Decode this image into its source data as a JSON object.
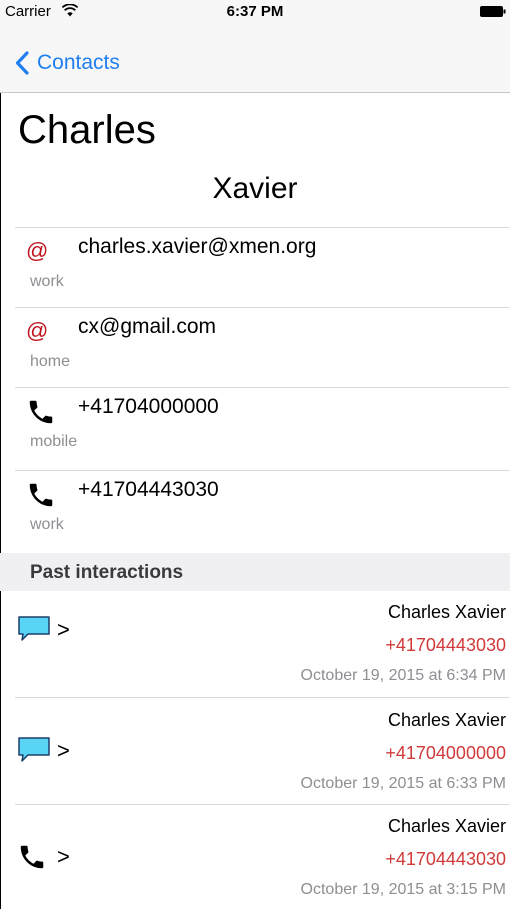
{
  "status_bar": {
    "carrier": "Carrier",
    "time": "6:37 PM",
    "wifi_icon": "wifi-icon",
    "battery_icon": "battery-icon"
  },
  "nav": {
    "back_label": "Contacts",
    "back_icon": "chevron-left-icon"
  },
  "contact": {
    "first_name": "Charles",
    "last_name": "Xavier"
  },
  "details": [
    {
      "icon": "at-sign-icon",
      "glyph": "@",
      "value": "charles.xavier@xmen.org",
      "label": "work"
    },
    {
      "icon": "at-sign-icon",
      "glyph": "@",
      "value": "cx@gmail.com",
      "label": "home"
    },
    {
      "icon": "phone-icon",
      "value": "+41704000000",
      "label": "mobile"
    },
    {
      "icon": "phone-icon",
      "value": "+41704443030",
      "label": "work"
    }
  ],
  "past_interactions": {
    "title": "Past interactions",
    "items": [
      {
        "icon": "message-bubble-icon",
        "chevron": ">",
        "name": "Charles Xavier",
        "phone": "+41704443030",
        "date": "October 19, 2015 at 6:34 PM"
      },
      {
        "icon": "message-bubble-icon",
        "chevron": ">",
        "name": "Charles Xavier",
        "phone": "+41704000000",
        "date": "October 19, 2015 at 6:33 PM"
      },
      {
        "icon": "phone-icon",
        "chevron": ">",
        "name": "Charles Xavier",
        "phone": "+41704443030",
        "date": "October 19, 2015 at 3:15 PM"
      }
    ]
  },
  "colors": {
    "accent": "#1f7ff0",
    "email_icon": "#c0151f",
    "interaction_phone": "#d03a3a",
    "secondary_text": "#8e8e93",
    "message_bubble": "#5ad4f5"
  }
}
